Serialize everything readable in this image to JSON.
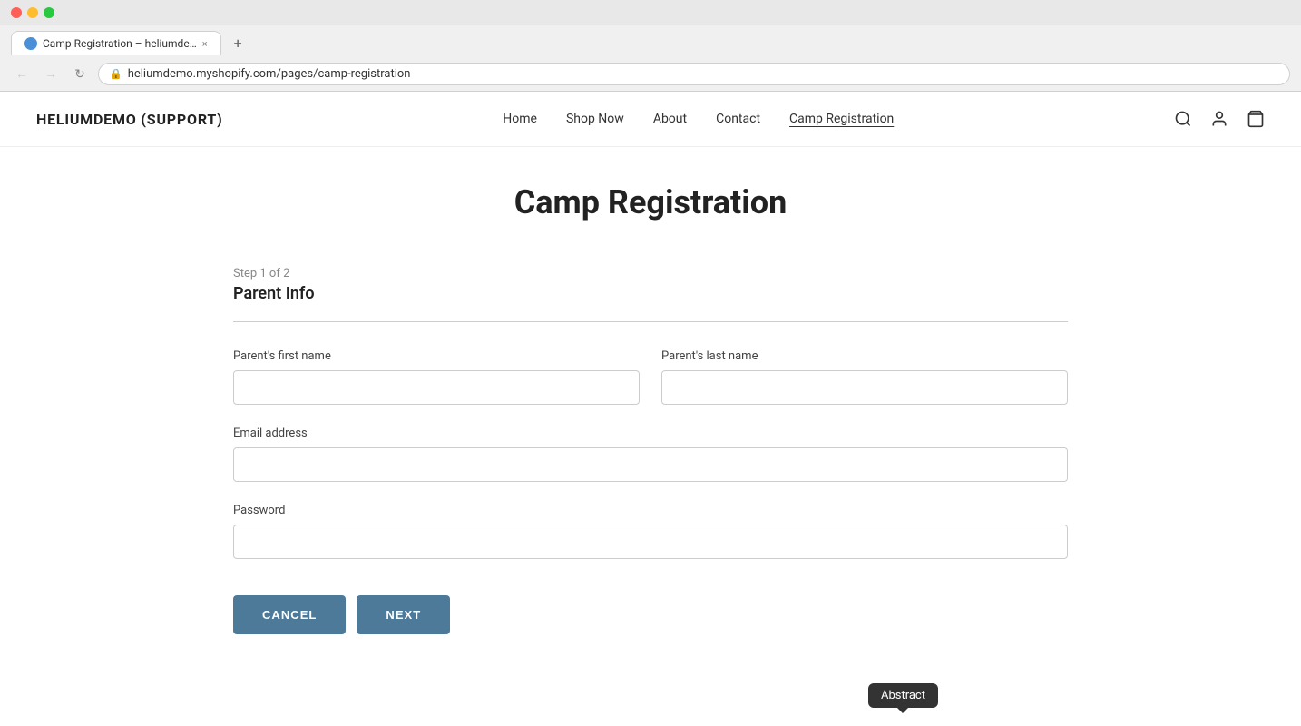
{
  "browser": {
    "dots": [
      "red",
      "yellow",
      "green"
    ],
    "tab": {
      "title": "Camp Registration – heliumde…",
      "favicon": "🌐",
      "close": "×"
    },
    "new_tab": "+",
    "address": {
      "lock_icon": "🔒",
      "url_base": "heliumdemo.myshopify.com",
      "url_path": "/pages/camp-registration"
    },
    "nav": {
      "back": "←",
      "forward": "→",
      "refresh": "↻"
    }
  },
  "site": {
    "logo": "HELIUMDEMO (SUPPORT)",
    "nav": [
      {
        "label": "Home",
        "active": false
      },
      {
        "label": "Shop Now",
        "active": false
      },
      {
        "label": "About",
        "active": false
      },
      {
        "label": "Contact",
        "active": false
      },
      {
        "label": "Camp Registration",
        "active": true
      }
    ],
    "icons": {
      "search": "🔍",
      "account": "👤",
      "cart": "🛍"
    }
  },
  "page": {
    "title": "Camp Registration",
    "step_label": "Step 1 of 2",
    "section_title": "Parent Info",
    "fields": {
      "first_name": {
        "label": "Parent's first name",
        "placeholder": ""
      },
      "last_name": {
        "label": "Parent's last name",
        "placeholder": ""
      },
      "email": {
        "label": "Email address",
        "placeholder": ""
      },
      "password": {
        "label": "Password",
        "placeholder": ""
      }
    },
    "buttons": {
      "cancel": "CANCEL",
      "next": "NEXT"
    }
  },
  "tooltip": {
    "text": "Abstract"
  }
}
